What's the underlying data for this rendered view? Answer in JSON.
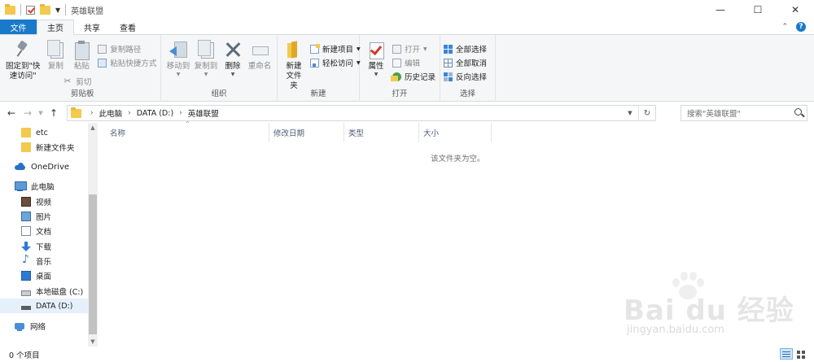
{
  "window": {
    "title": "英雄联盟",
    "controls": {
      "minimize": "—",
      "maximize": "☐",
      "close": "✕"
    }
  },
  "tabs": [
    {
      "label": "文件"
    },
    {
      "label": "主页"
    },
    {
      "label": "共享"
    },
    {
      "label": "查看"
    }
  ],
  "ribbon": {
    "clipboard": {
      "pin_label": "固定到\"快\n速访问\"",
      "copy_label": "复制",
      "paste_label": "粘贴",
      "copy_path_label": "复制路径",
      "paste_shortcut_label": "粘贴快捷方式",
      "cut_label": "剪切",
      "group_label": "剪贴板"
    },
    "organize": {
      "move_to_label": "移动到",
      "copy_to_label": "复制到",
      "delete_label": "删除",
      "rename_label": "重命名",
      "group_label": "组织"
    },
    "new": {
      "new_folder_label": "新建\n文件夹",
      "new_item_label": "新建项目",
      "easy_access_label": "轻松访问",
      "group_label": "新建"
    },
    "open": {
      "properties_label": "属性",
      "open_label": "打开",
      "edit_label": "编辑",
      "history_label": "历史记录",
      "group_label": "打开"
    },
    "select": {
      "select_all_label": "全部选择",
      "select_none_label": "全部取消",
      "invert_label": "反向选择",
      "group_label": "选择"
    }
  },
  "address": {
    "crumbs": [
      "此电脑",
      "DATA (D:)",
      "英雄联盟"
    ],
    "search_placeholder": "搜索\"英雄联盟\""
  },
  "nav": {
    "items": [
      {
        "label": "etc"
      },
      {
        "label": "新建文件夹"
      },
      {
        "label": "OneDrive"
      },
      {
        "label": "此电脑"
      },
      {
        "label": "视频"
      },
      {
        "label": "图片"
      },
      {
        "label": "文档"
      },
      {
        "label": "下载"
      },
      {
        "label": "音乐"
      },
      {
        "label": "桌面"
      },
      {
        "label": "本地磁盘 (C:)"
      },
      {
        "label": "DATA (D:)"
      },
      {
        "label": "网络"
      }
    ]
  },
  "content": {
    "columns": [
      "名称",
      "修改日期",
      "类型",
      "大小"
    ],
    "empty_message": "该文件夹为空。"
  },
  "status": {
    "item_count": "0 个项目"
  },
  "watermark": {
    "brand": "Bai du 经验",
    "url": "jingyan.baidu.com"
  }
}
